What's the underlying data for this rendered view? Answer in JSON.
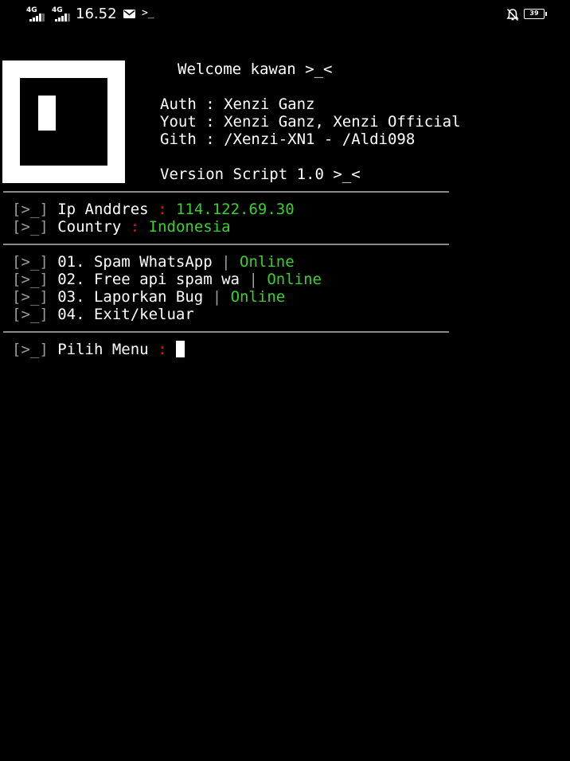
{
  "status_bar": {
    "network_1": "4G",
    "network_2": "4G",
    "time": "16.52",
    "battery_level": "39",
    "icons": [
      "signal-icon",
      "signal-icon",
      "mail-icon",
      "terminal-icon",
      "bell-off-icon",
      "battery-icon"
    ]
  },
  "banner": {
    "welcome": "Welcome kawan >_<",
    "auth_label": "Auth",
    "auth_value": "Xenzi Ganz",
    "yout_label": "Yout",
    "yout_value": "Xenzi Ganz, Xenzi Official",
    "gith_label": "Gith",
    "gith_value": "/Xenzi-XN1 - /Aldi098",
    "version": "Version Script 1.0 >_<"
  },
  "prompt_marker": "[>_]",
  "info": {
    "ip_label": "Ip Anddres",
    "ip_value": "114.122.69.30",
    "country_label": "Country",
    "country_value": "Indonesia"
  },
  "menu": {
    "items": [
      {
        "label": "01. Spam WhatsApp",
        "status": "Online"
      },
      {
        "label": "02. Free api spam wa",
        "status": "Online"
      },
      {
        "label": "03. Laporkan Bug",
        "status": "Online"
      },
      {
        "label": "04. Exit/keluar"
      }
    ]
  },
  "input": {
    "label": "Pilih Menu"
  },
  "colors": {
    "background": "#000000",
    "text": "#ffffff",
    "separator": "#d01818",
    "status_online": "#39d12b",
    "bracket": "#9a9a9a"
  }
}
